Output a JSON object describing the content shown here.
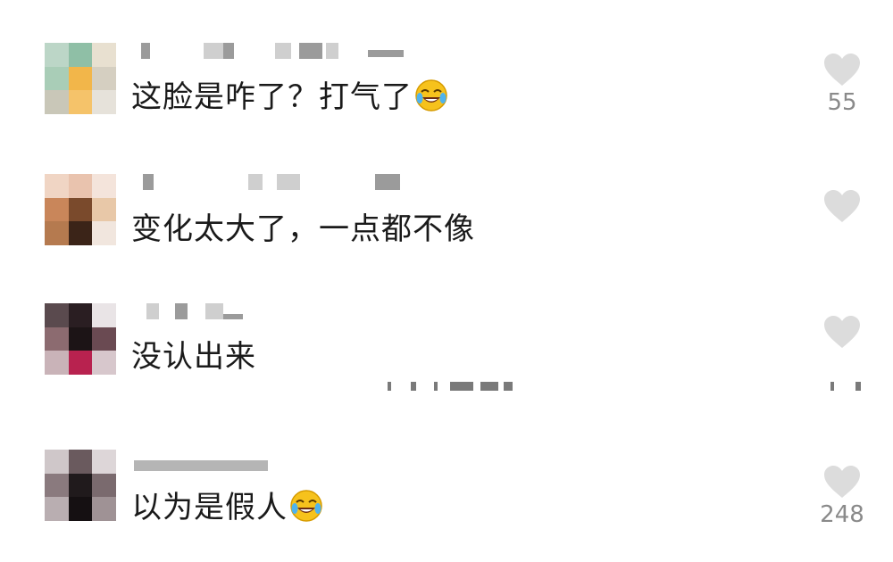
{
  "comments": [
    {
      "text": "这脸是咋了？打气了",
      "emoji": "laughing-crying-emoji",
      "likes": "55"
    },
    {
      "text": "变化太大了，一点都不像",
      "likes": ""
    },
    {
      "text": "没认出来",
      "likes": ""
    },
    {
      "text": "以为是假人",
      "emoji": "laughing-crying-emoji",
      "likes": "248"
    }
  ],
  "colors": {
    "text": "#1a1a1a",
    "heart": "#dcdcdc",
    "count": "#8a8a8a",
    "emoji_face": "#f6c21c"
  }
}
